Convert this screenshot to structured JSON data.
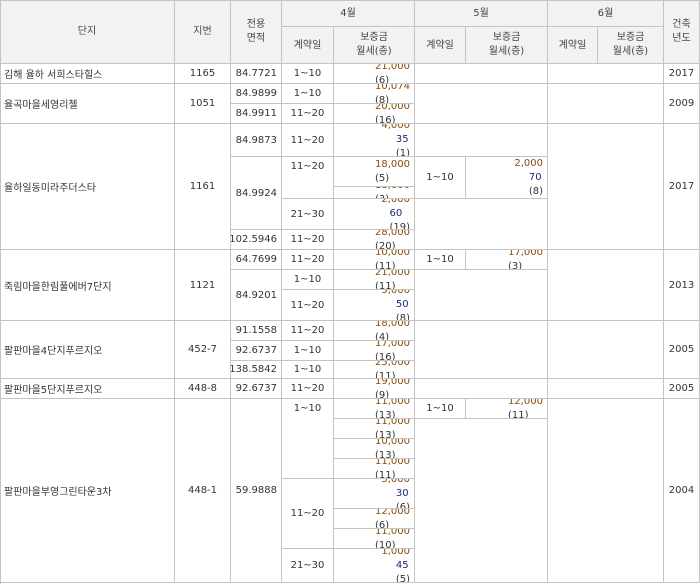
{
  "headers": {
    "complex": "단지",
    "lot": "지번",
    "area_line1": "전용",
    "area_line2": "면적",
    "months": [
      "4월",
      "5월",
      "6월"
    ],
    "contract_date": "계약일",
    "price_line1": "보증금",
    "price_line2": "월세(층)",
    "built_line1": "건축",
    "built_line2": "년도"
  },
  "complexes": [
    {
      "name": "김해 율하 서희스타힐스",
      "lot": "1165",
      "built": "2017",
      "areas": [
        "84.7721"
      ],
      "apr": [
        {
          "date": "1~10",
          "dep": "21,000",
          "mon": "",
          "fl": "(6)"
        }
      ],
      "may": []
    },
    {
      "name": "율곡마을세영리첼",
      "lot": "1051",
      "built": "2009",
      "areas": [
        "84.9899",
        "84.9911"
      ],
      "apr": [
        {
          "date": "1~10",
          "dep": "10,074",
          "mon": "",
          "fl": "(8)"
        },
        {
          "date": "11~20",
          "dep": "20,000",
          "mon": "",
          "fl": "(16)"
        }
      ],
      "may": []
    },
    {
      "name": "율하일동미라주더스타",
      "lot": "1161",
      "built": "2017",
      "areas": [
        "84.9873",
        "84.9924",
        "102.5946"
      ],
      "apr": [
        {
          "date": "11~20",
          "dep": "4,000",
          "mon": "35",
          "fl": "(1)"
        },
        {
          "date": "11~20",
          "dep": "18,000",
          "mon": "",
          "fl": "(5)"
        },
        {
          "date": "",
          "dep": "18,000",
          "mon": "",
          "fl": "(3)"
        },
        {
          "date": "21~30",
          "dep": "2,000",
          "mon": "60",
          "fl": "(19)"
        },
        {
          "date": "11~20",
          "dep": "28,000",
          "mon": "",
          "fl": "(20)"
        }
      ],
      "may": [
        {
          "date": "1~10",
          "dep": "2,000",
          "mon": "70",
          "fl": "(8)"
        }
      ]
    },
    {
      "name": "죽림마을한림풀에버7단지",
      "lot": "1121",
      "built": "2013",
      "areas": [
        "64.7699",
        "84.9201"
      ],
      "apr": [
        {
          "date": "11~20",
          "dep": "10,000",
          "mon": "",
          "fl": "(11)"
        },
        {
          "date": "1~10",
          "dep": "21,000",
          "mon": "",
          "fl": "(11)"
        },
        {
          "date": "11~20",
          "dep": "5,000",
          "mon": "50",
          "fl": "(8)"
        }
      ],
      "may": [
        {
          "date": "1~10",
          "dep": "17,000",
          "mon": "",
          "fl": "(3)"
        }
      ]
    },
    {
      "name": "팔판마을4단지푸르지오",
      "lot": "452-7",
      "built": "2005",
      "areas": [
        "91.1558",
        "92.6737",
        "138.5842"
      ],
      "apr": [
        {
          "date": "11~20",
          "dep": "18,000",
          "mon": "",
          "fl": "(4)"
        },
        {
          "date": "1~10",
          "dep": "17,000",
          "mon": "",
          "fl": "(16)"
        },
        {
          "date": "1~10",
          "dep": "25,000",
          "mon": "",
          "fl": "(11)"
        }
      ],
      "may": []
    },
    {
      "name": "팔판마을5단지푸르지오",
      "lot": "448-8",
      "built": "2005",
      "areas": [
        "92.6737"
      ],
      "apr": [
        {
          "date": "11~20",
          "dep": "19,000",
          "mon": "",
          "fl": "(9)"
        }
      ],
      "may": []
    },
    {
      "name": "팔판마을부영그린타운3차",
      "lot": "448-1",
      "built": "2004",
      "areas": [
        "59.9888"
      ],
      "apr": [
        {
          "date": "1~10",
          "dep": "11,000",
          "mon": "",
          "fl": "(13)"
        },
        {
          "date": "",
          "dep": "11,000",
          "mon": "",
          "fl": "(13)"
        },
        {
          "date": "",
          "dep": "10,000",
          "mon": "",
          "fl": "(13)"
        },
        {
          "date": "",
          "dep": "11,000",
          "mon": "",
          "fl": "(11)"
        },
        {
          "date": "11~20",
          "dep": "5,000",
          "mon": "30",
          "fl": "(6)"
        },
        {
          "date": "",
          "dep": "12,000",
          "mon": "",
          "fl": "(6)"
        },
        {
          "date": "",
          "dep": "11,000",
          "mon": "",
          "fl": "(10)"
        },
        {
          "date": "21~30",
          "dep": "1,000",
          "mon": "45",
          "fl": "(5)"
        }
      ],
      "may": [
        {
          "date": "1~10",
          "dep": "12,000",
          "mon": "",
          "fl": "(11)"
        }
      ]
    }
  ]
}
